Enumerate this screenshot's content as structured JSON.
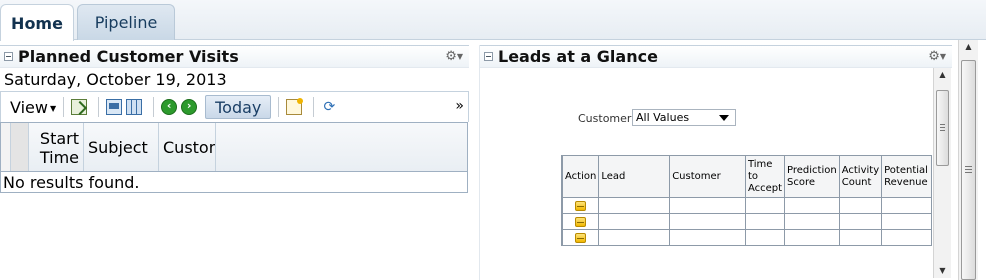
{
  "tabs": [
    {
      "label": "Home",
      "active": true
    },
    {
      "label": "Pipeline",
      "active": false
    }
  ],
  "left_panel": {
    "title": "Planned Customer Visits",
    "date": "Saturday, October 19, 2013",
    "toolbar": {
      "view_label": "View",
      "today_label": "Today",
      "more_label": "»",
      "prev_glyph": "‹",
      "next_glyph": "›",
      "sync_glyph": "⟳",
      "icons": [
        "export-icon",
        "card-view-icon",
        "grid-view-icon",
        "previous-icon",
        "next-icon",
        "new-appointment-icon",
        "synchronize-icon"
      ]
    },
    "columns": [
      "Start Time",
      "Subject",
      "Customer"
    ],
    "empty_text": "No results found."
  },
  "right_panel": {
    "title": "Leads at a Glance",
    "filter": {
      "label": "Customer",
      "value": "All Values"
    },
    "columns": [
      "Action",
      "Lead",
      "Customer",
      "Time to Accept",
      "Prediction Score",
      "Activity Count",
      "Potential Revenue"
    ],
    "rows": 3
  },
  "colors": {
    "accent": "#173c5e",
    "tab_active_bg": "#ffffff",
    "action_icon": "#f2b800"
  }
}
